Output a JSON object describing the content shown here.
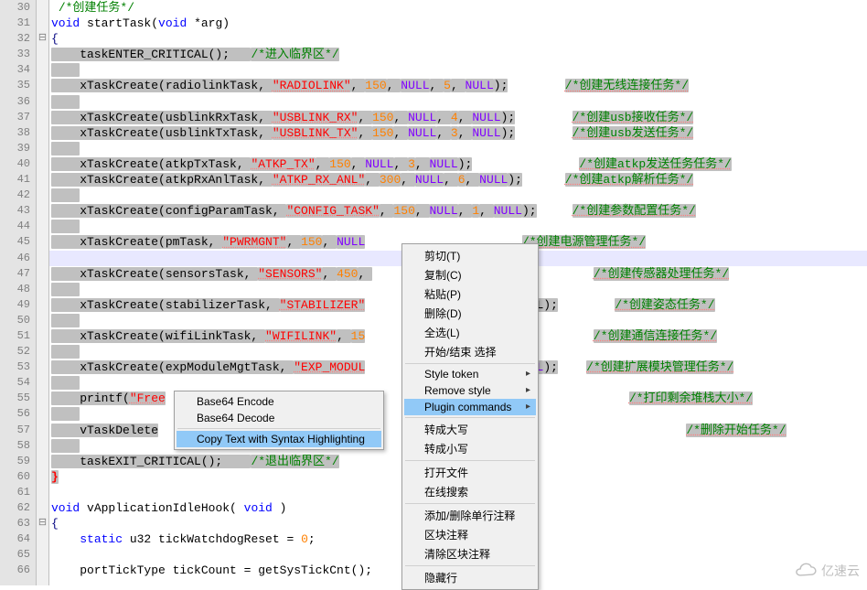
{
  "gutter": [
    "30",
    "31",
    "32",
    "33",
    "34",
    "35",
    "36",
    "37",
    "38",
    "39",
    "40",
    "41",
    "42",
    "43",
    "44",
    "45",
    "46",
    "47",
    "48",
    "49",
    "50",
    "51",
    "52",
    "53",
    "54",
    "55",
    "56",
    "57",
    "58",
    "59",
    "60",
    "61",
    "62",
    "63",
    "64",
    "65",
    "66"
  ],
  "fold": [
    "",
    "",
    "⊟",
    "",
    "",
    "",
    "",
    "",
    "",
    "",
    "",
    "",
    "",
    "",
    "",
    "",
    "",
    "",
    "",
    "",
    "",
    "",
    "",
    "",
    "",
    "",
    "",
    "",
    "",
    "",
    "",
    "",
    "",
    "⊟",
    "",
    "",
    ""
  ],
  "lines": {
    "l30": {
      "c": "/*创建任务*/"
    },
    "l31": {
      "a": "void",
      "b": " startTask(",
      "c": "void",
      "d": " *arg)"
    },
    "l32": {
      "a": "{"
    },
    "l33": {
      "a": "    taskENTER_CRITICAL();   ",
      "c": "/*进入临界区*/"
    },
    "l35": {
      "a": "    xTaskCreate(radiolinkTask, ",
      "s": "\"RADIOLINK\"",
      "b": ", ",
      "n1": "150",
      "c": ", ",
      "k1": "NULL",
      "d": ", ",
      "n2": "5",
      "e": ", ",
      "k2": "NULL",
      "f": ");",
      "cm": "/*创建无线连接任务*/"
    },
    "l37": {
      "a": "    xTaskCreate(usblinkRxTask, ",
      "s": "\"USBLINK_RX\"",
      "b": ", ",
      "n1": "150",
      "c": ", ",
      "k1": "NULL",
      "d": ", ",
      "n2": "4",
      "e": ", ",
      "k2": "NULL",
      "f": ");",
      "cm": "/*创建usb接收任务*/"
    },
    "l38": {
      "a": "    xTaskCreate(usblinkTxTask, ",
      "s": "\"USBLINK_TX\"",
      "b": ", ",
      "n1": "150",
      "c": ", ",
      "k1": "NULL",
      "d": ", ",
      "n2": "3",
      "e": ", ",
      "k2": "NULL",
      "f": ");",
      "cm": "/*创建usb发送任务*/"
    },
    "l40": {
      "a": "    xTaskCreate(atkpTxTask, ",
      "s": "\"ATKP_TX\"",
      "b": ", ",
      "n1": "150",
      "c": ", ",
      "k1": "NULL",
      "d": ", ",
      "n2": "3",
      "e": ", ",
      "k2": "NULL",
      "f": ");",
      "cm": "/*创建atkp发送任务任务*/"
    },
    "l41": {
      "a": "    xTaskCreate(atkpRxAnlTask, ",
      "s": "\"ATKP_RX_ANL\"",
      "b": ", ",
      "n1": "300",
      "c": ", ",
      "k1": "NULL",
      "d": ", ",
      "n2": "6",
      "e": ", ",
      "k2": "NULL",
      "f": ");",
      "cm": "/*创建atkp解析任务*/"
    },
    "l43": {
      "a": "    xTaskCreate(configParamTask, ",
      "s": "\"CONFIG_TASK\"",
      "b": ", ",
      "n1": "150",
      "c": ", ",
      "k1": "NULL",
      "d": ", ",
      "n2": "1",
      "e": ", ",
      "k2": "NULL",
      "f": ");",
      "cm": "/*创建参数配置任务*/"
    },
    "l45": {
      "a": "    xTaskCreate(pmTask, ",
      "s": "\"PWRMGNT\"",
      "b": ", ",
      "n1": "150",
      "c": ", ",
      "k1": "NULL",
      "cm": "/*创建电源管理任务*/"
    },
    "l47": {
      "a": "    xTaskCreate(sensorsTask, ",
      "s": "\"SENSORS\"",
      "b": ", ",
      "n1": "450",
      "c": ", ",
      "cm": "/*创建传感器处理任务*/"
    },
    "l49": {
      "a": "    xTaskCreate(stabilizerTask, ",
      "s": "\"STABILIZER\"",
      "tail": "L);",
      "cm": "/*创建姿态任务*/"
    },
    "l51": {
      "a": "    xTaskCreate(wifiLinkTask, ",
      "s": "\"WIFILINK\"",
      "b": ", ",
      "n1": "15",
      "cm": "/*创建通信连接任务*/"
    },
    "l53": {
      "a": "    xTaskCreate(expModuleMgtTask, ",
      "s": "\"EXP_MODUL",
      "k1": "ULL",
      "f": ");",
      "cm": "/*创建扩展模块管理任务*/"
    },
    "l55": {
      "a": "    printf(",
      "s": "\"Free",
      "cm": "/*打印剩余堆栈大小*/"
    },
    "l57": {
      "a": "    vTaskDelete",
      "cm": "/*删除开始任务*/"
    },
    "l59": {
      "a": "    taskEXIT_CRITICAL();    ",
      "c": "/*退出临界区*/"
    },
    "l60": {
      "a": "}"
    },
    "l62": {
      "a": "void",
      "b": " vApplicationIdleHook( ",
      "c": "void",
      "d": " )"
    },
    "l63": {
      "a": "{"
    },
    "l64": {
      "a": "    ",
      "k": "static",
      "b": " u32 tickWatchdogReset = ",
      "n": "0",
      "c": ";"
    },
    "l66": {
      "a": "    portTickType tickCount = getSysTickCnt();"
    }
  },
  "menu_main": {
    "items": [
      {
        "label": "剪切(T)"
      },
      {
        "label": "复制(C)"
      },
      {
        "label": "粘贴(P)"
      },
      {
        "label": "删除(D)"
      },
      {
        "label": "全选(L)"
      },
      {
        "label": "开始/结束 选择"
      },
      {
        "sep": true
      },
      {
        "label": "Style token",
        "sub": true
      },
      {
        "label": "Remove style",
        "sub": true
      },
      {
        "label": "Plugin commands",
        "sub": true,
        "hi": true
      },
      {
        "sep": true
      },
      {
        "label": "转成大写"
      },
      {
        "label": "转成小写"
      },
      {
        "sep": true
      },
      {
        "label": "打开文件"
      },
      {
        "label": "在线搜索"
      },
      {
        "sep": true
      },
      {
        "label": "添加/删除单行注释"
      },
      {
        "label": "区块注释"
      },
      {
        "label": "清除区块注释"
      },
      {
        "sep": true
      },
      {
        "label": "隐藏行"
      }
    ]
  },
  "menu_sub": {
    "items": [
      {
        "label": "Base64 Encode"
      },
      {
        "label": "Base64 Decode"
      },
      {
        "sep": true
      },
      {
        "label": "Copy Text with Syntax Highlighting",
        "hi": true
      }
    ]
  },
  "watermark": "亿速云"
}
